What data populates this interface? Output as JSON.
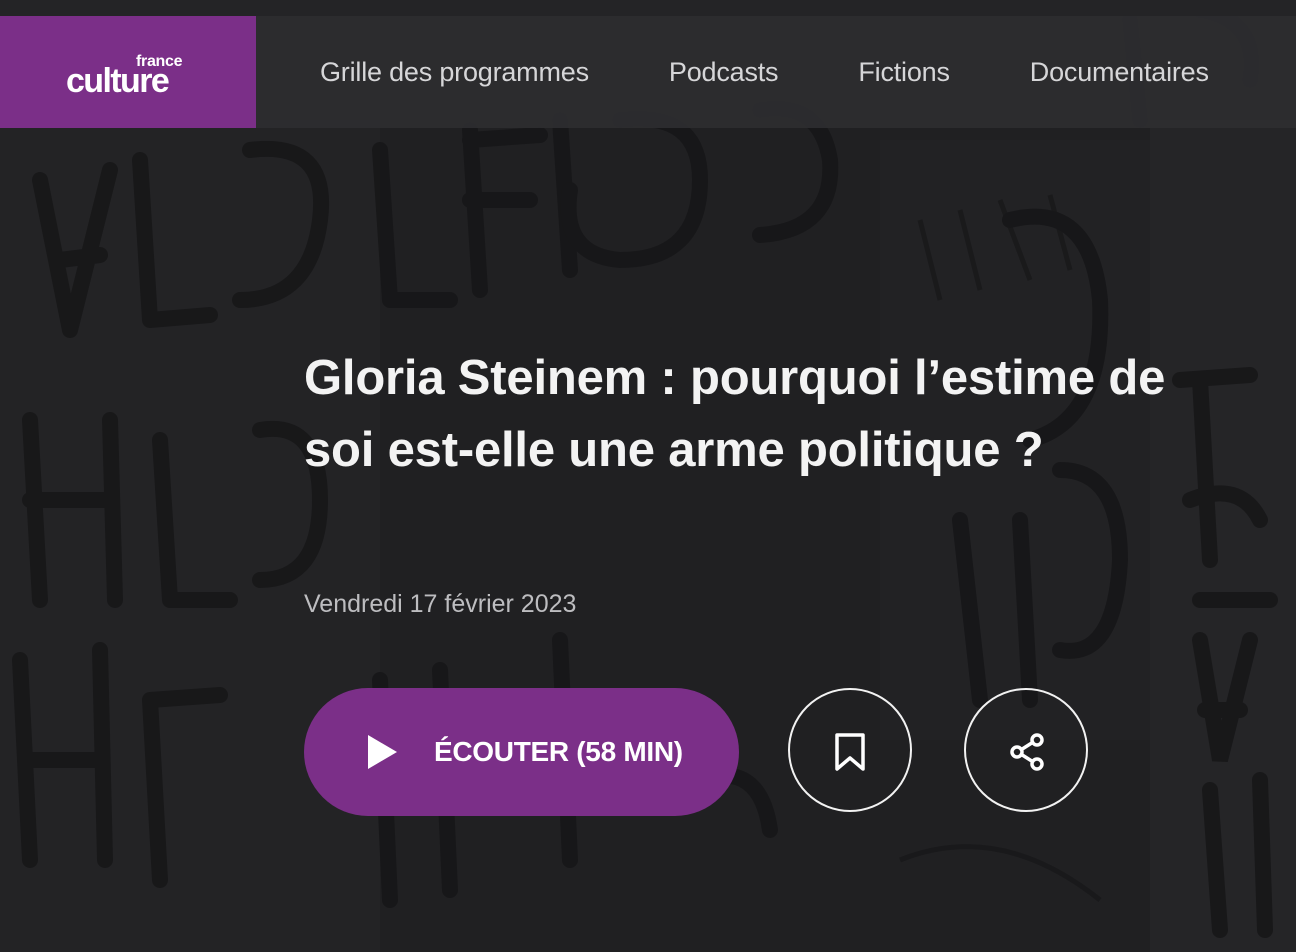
{
  "header": {
    "logo": {
      "small": "france",
      "big": "culture"
    },
    "nav": [
      {
        "label": "Grille des programmes"
      },
      {
        "label": "Podcasts"
      },
      {
        "label": "Fictions"
      },
      {
        "label": "Documentaires"
      }
    ]
  },
  "episode": {
    "title": "Gloria Steinem : pourquoi l’estime de soi est-elle une arme politique ?",
    "date": "Vendredi 17 février 2023",
    "listen_label": "ÉCOUTER (58 MIN)"
  },
  "icons": {
    "play": "play-icon",
    "bookmark": "bookmark-icon",
    "share": "share-icon"
  },
  "colors": {
    "brand": "#7b2f88",
    "header_bg": "#2e2e30",
    "text": "#f3f3f3",
    "muted_text": "#bdbdc0"
  }
}
